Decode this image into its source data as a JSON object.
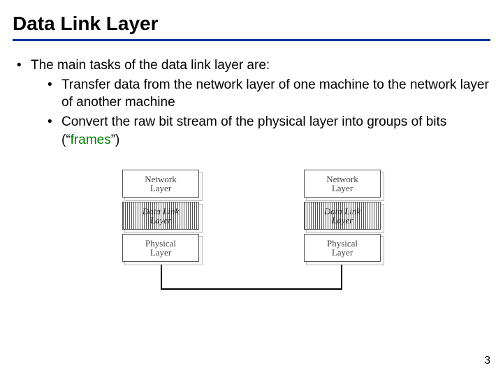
{
  "title": "Data Link Layer",
  "bullets": {
    "intro": "The main tasks of the data link layer are:",
    "item1": "Transfer data from the network layer of one machine to the network layer of another machine",
    "item2_pre": "Convert the raw bit stream of the physical layer into groups of bits (“",
    "item2_green": "frames",
    "item2_post": "”)"
  },
  "diagram": {
    "network_line1": "Network",
    "network_line2": "Layer",
    "datalink_line1": "Data Link",
    "datalink_line2": "Layer",
    "physical_line1": "Physical",
    "physical_line2": "Layer"
  },
  "page_number": "3"
}
